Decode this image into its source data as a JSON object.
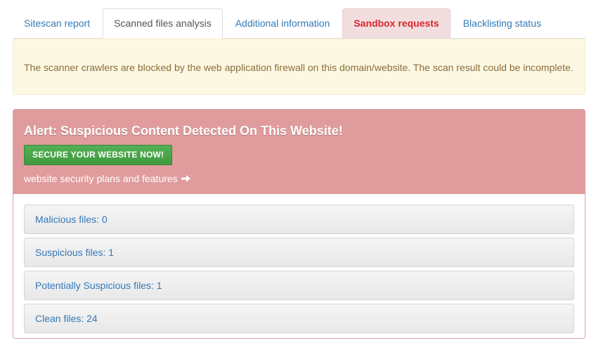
{
  "tabs": [
    {
      "label": "Sitescan report"
    },
    {
      "label": "Scanned files analysis"
    },
    {
      "label": "Additional information"
    },
    {
      "label": "Sandbox requests"
    },
    {
      "label": "Blacklisting status"
    }
  ],
  "warning": {
    "text": "The scanner crawlers are blocked by the web application firewall on this domain/website. The scan result could be incomplete."
  },
  "alert": {
    "title": "Alert: Suspicious Content Detected On This Website!",
    "cta_label": "SECURE YOUR WEBSITE NOW!",
    "plans_link": "website security plans and features",
    "plans_icon": "arrow-right-icon"
  },
  "files": [
    {
      "label": "Malicious files: 0"
    },
    {
      "label": "Suspicious files: 1"
    },
    {
      "label": "Potentially Suspicious files: 1"
    },
    {
      "label": "Clean files: 24"
    }
  ],
  "colors": {
    "link": "#337ab7",
    "danger_tab_bg": "#f2dede",
    "danger_tab_text": "#d9262f",
    "warning_bg": "#fcf8e3",
    "warning_text": "#8a6d3b",
    "alert_bg": "#e09c9c",
    "cta_bg": "#449d44"
  }
}
